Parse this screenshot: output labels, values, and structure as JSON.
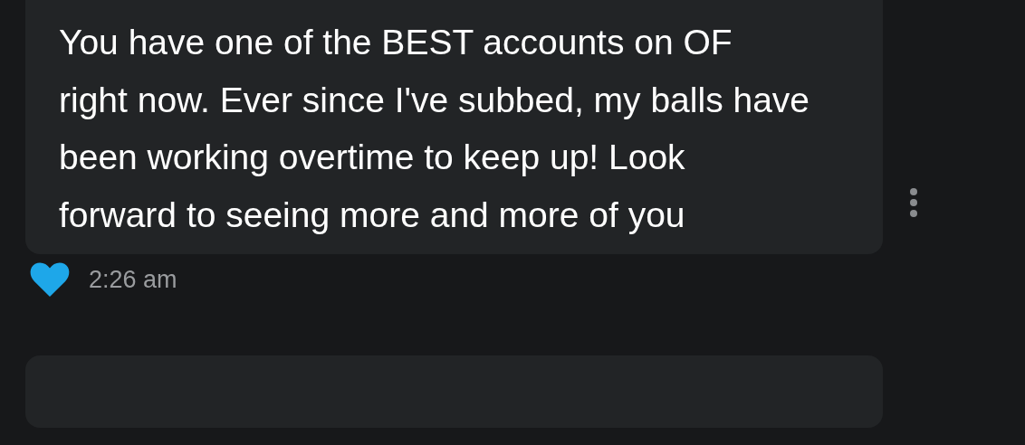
{
  "messages": [
    {
      "kind": "full",
      "text": "You have one of the BEST accounts on OF right now. Ever since I've subbed, my balls have been working overtime to keep up! Look forward to seeing more and more of you",
      "liked": true,
      "time": "2:26 am"
    },
    {
      "kind": "cut-off"
    }
  ]
}
